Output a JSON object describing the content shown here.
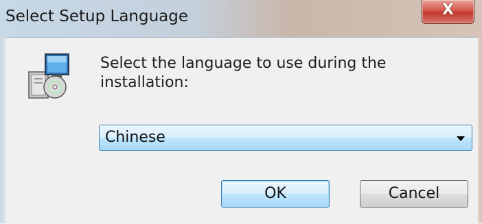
{
  "window": {
    "title": "Select Setup Language",
    "close_label": "X"
  },
  "dialog": {
    "prompt": "Select the language to use during the installation:",
    "icon": "setup-installer-icon",
    "language_select": {
      "selected": "Chinese"
    },
    "buttons": {
      "ok": "OK",
      "cancel": "Cancel"
    }
  },
  "colors": {
    "accent": "#3c7fb1",
    "close": "#c23b2e",
    "background": "#f0f0f0"
  }
}
